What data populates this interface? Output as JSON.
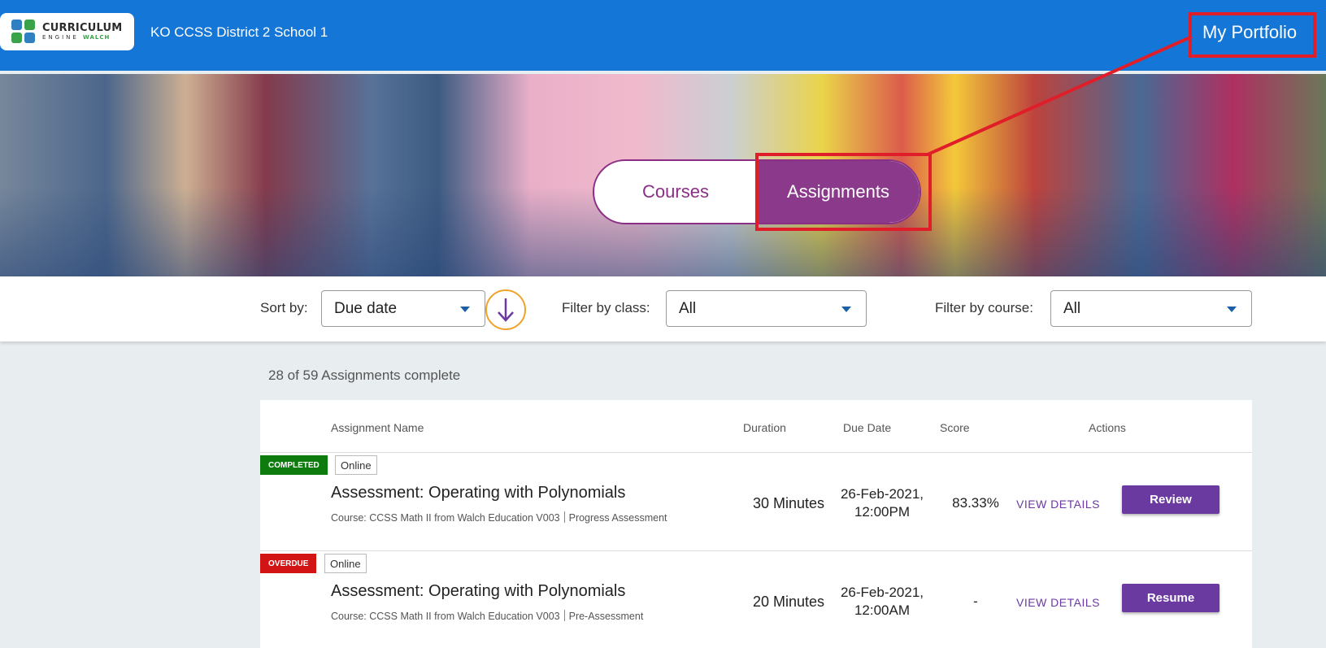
{
  "header": {
    "logo_text_main": "CURRICULUM",
    "logo_text_sub": "ENGINE",
    "logo_text_brand": "WALCH",
    "school_name": "KO CCSS District 2 School 1",
    "portfolio_link": "My Portfolio"
  },
  "hero": {
    "tabs": [
      {
        "label": "Courses",
        "active": false
      },
      {
        "label": "Assignments",
        "active": true
      }
    ]
  },
  "filters": {
    "sort_label": "Sort by:",
    "sort_value": "Due date",
    "class_label": "Filter by class:",
    "class_value": "All",
    "course_label": "Filter by course:",
    "course_value": "All"
  },
  "progress_text": "28 of 59 Assignments complete",
  "table": {
    "columns": {
      "name": "Assignment Name",
      "duration": "Duration",
      "due": "Due Date",
      "score": "Score",
      "actions": "Actions"
    },
    "rows": [
      {
        "status": "COMPLETED",
        "mode": "Online",
        "name": "Assessment: Operating with Polynomials",
        "course": "Course: CCSS Math II from Walch Education V003",
        "type": "Progress Assessment",
        "duration": "30 Minutes",
        "due_line1": "26-Feb-2021,",
        "due_line2": "12:00PM",
        "score": "83.33%",
        "details": "VIEW DETAILS",
        "action": "Review"
      },
      {
        "status": "OVERDUE",
        "mode": "Online",
        "name": "Assessment: Operating with Polynomials",
        "course": "Course: CCSS Math II from Walch Education V003",
        "type": "Pre-Assessment",
        "duration": "20 Minutes",
        "due_line1": "26-Feb-2021,",
        "due_line2": "12:00AM",
        "score": "-",
        "details": "VIEW DETAILS",
        "action": "Resume"
      }
    ]
  },
  "colors": {
    "header_blue": "#1476d6",
    "accent_purple": "#8b3a8b",
    "button_purple": "#6b3aa0",
    "completed_green": "#0e7b0e",
    "overdue_red": "#d21414",
    "annotation_red": "#e01e2a",
    "sort_ring_orange": "#f0a22a"
  }
}
